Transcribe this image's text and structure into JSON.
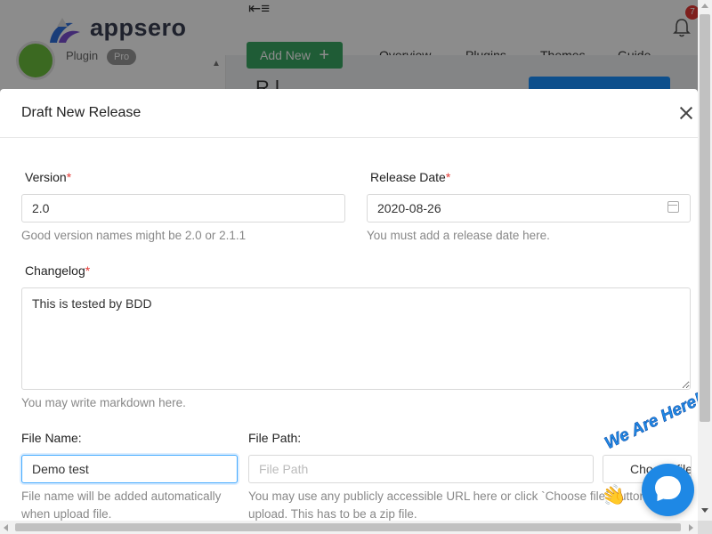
{
  "app": {
    "brand": "appsero",
    "notification_count": "7",
    "sidebar": {
      "plugin_label": "Plugin",
      "pro_badge": "Pro"
    },
    "toolbar": {
      "add_new_label": "Add New",
      "add_new_icon": "+"
    },
    "tabs": [
      "Overview",
      "Plugins",
      "Themes",
      "Guide"
    ],
    "page_title_partial": "R l",
    "accent_color": "#3aa863",
    "primary_color": "#1890ff"
  },
  "modal": {
    "title": "Draft New Release",
    "version": {
      "label": "Version",
      "required_mark": "*",
      "value": "2.0",
      "help": "Good version names might be 2.0 or 2.1.1"
    },
    "release_date": {
      "label": "Release Date",
      "required_mark": "*",
      "value": "2020-08-26",
      "help": "You must add a release date here.",
      "icon": "calendar-icon"
    },
    "changelog": {
      "label": "Changelog",
      "required_mark": "*",
      "value": "This is tested by BDD",
      "help": "You may write markdown here."
    },
    "file_name": {
      "label": "File Name:",
      "value": "Demo test",
      "help": "File name will be added automatically when upload file."
    },
    "file_path": {
      "label": "File Path:",
      "placeholder": "File Path",
      "help": "You may use any publicly accessible URL here or click `Choose file` button to upload. This has to be a zip file."
    },
    "choose_file_button": "Choose file"
  },
  "chat_widget": {
    "tagline": "We Are Here!",
    "icon": "chat-bubble-icon",
    "wave_icon": "waving-hand-icon",
    "color": "#1e88e5"
  }
}
